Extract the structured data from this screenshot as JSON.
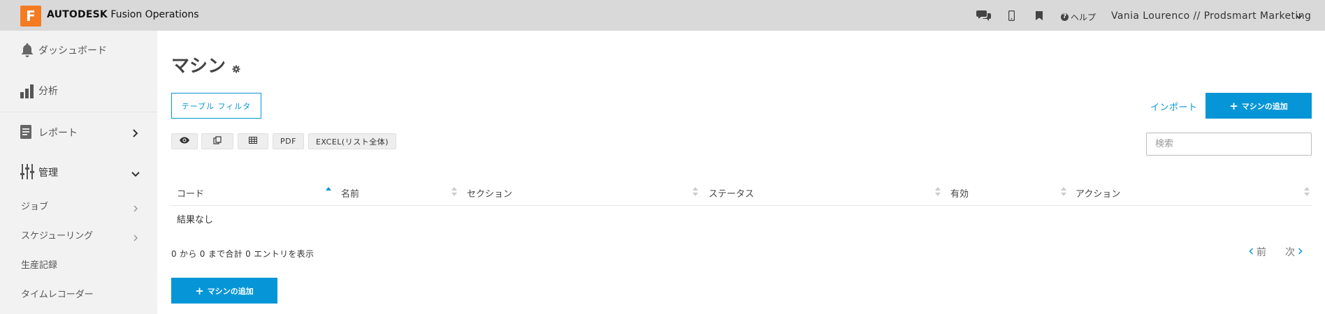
{
  "topbar": {
    "brand_bold": "AUTODESK",
    "brand_rest": "Fusion Operations",
    "logo_letter": "F",
    "icons": [
      "chat-icon",
      "mobile-icon",
      "bookmark-icon"
    ],
    "help_label": "ヘルプ",
    "user_label": "Vania Lourenco // Prodsmart Marketing"
  },
  "sidebar": {
    "items": [
      {
        "label": "ダッシュボード",
        "icon": "bell-icon"
      },
      {
        "label": "分析",
        "icon": "bar-chart-icon"
      },
      {
        "label": "レポート",
        "icon": "document-icon"
      },
      {
        "label": "管理",
        "icon": "sliders-icon"
      }
    ],
    "sub_items": [
      {
        "label": "ジョブ"
      },
      {
        "label": "スケジューリング"
      },
      {
        "label": "生産記録"
      },
      {
        "label": "タイムレコーダー"
      }
    ]
  },
  "main": {
    "title": "マシン",
    "filter_button": "テーブル フィルタ",
    "import_link": "インポート",
    "add_button": "マシンの追加",
    "toolbar": {
      "pdf": "PDF",
      "excel": "EXCEL(リスト全体)"
    },
    "search_placeholder": "検索",
    "table": {
      "headers": [
        "コード",
        "名前",
        "セクション",
        "ステータス",
        "有効",
        "アクション"
      ],
      "empty_text": "結果なし"
    },
    "info_text": "0 から 0 まで合計 0 エントリを表示",
    "pager": {
      "prev": "前",
      "next": "次"
    },
    "bottom_add_button": "マシンの追加"
  },
  "colors": {
    "accent": "#0696d7",
    "logo": "#f47b20",
    "topbar": "#d9d9d9",
    "sidebar": "#f2f2f2"
  }
}
